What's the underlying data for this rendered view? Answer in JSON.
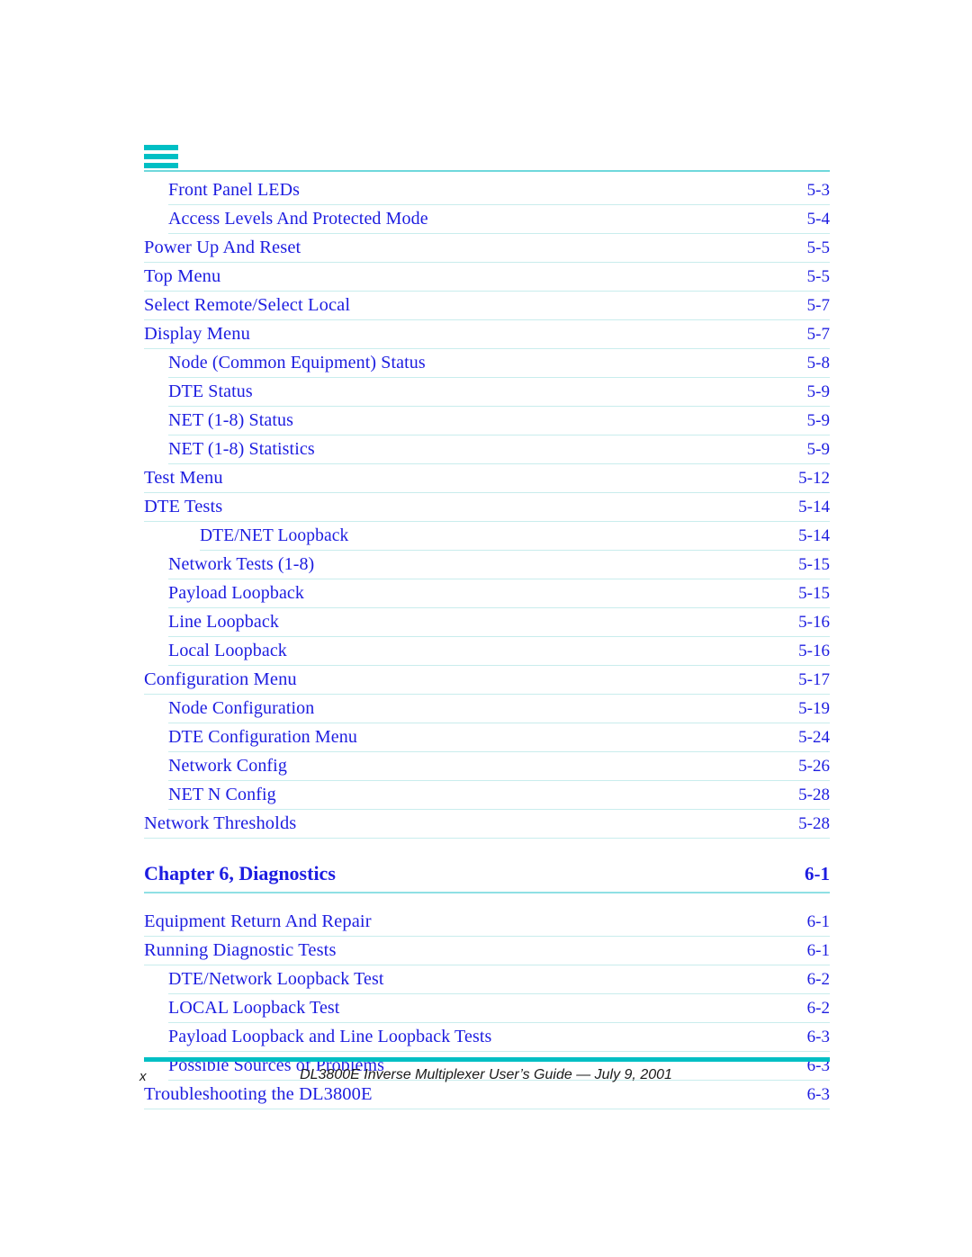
{
  "document": {
    "footer_text": "DL3800E Inverse Multiplexer User’s Guide — July 9, 2001",
    "folio": "x"
  },
  "header": {
    "mark_icon": "three-bar-mark-icon",
    "mark_color": "#00bfc4"
  },
  "colors": {
    "link_blue": "#1d1de0",
    "teal": "#00bfc4",
    "rule_teal": "#c9eded"
  },
  "toc": {
    "entries": [
      {
        "label": "Front Panel LEDs",
        "page": "5-3",
        "level": 2
      },
      {
        "label": "Access Levels And Protected Mode",
        "page": "5-4",
        "level": 2
      },
      {
        "label": "Power Up And Reset",
        "page": "5-5",
        "level": 1
      },
      {
        "label": "Top Menu",
        "page": "5-5",
        "level": 1
      },
      {
        "label": "Select Remote/Select Local",
        "page": "5-7",
        "level": 1
      },
      {
        "label": "Display Menu",
        "page": "5-7",
        "level": 1
      },
      {
        "label": "Node (Common Equipment) Status",
        "page": "5-8",
        "level": 2
      },
      {
        "label": "DTE Status",
        "page": "5-9",
        "level": 2
      },
      {
        "label": "NET (1-8) Status",
        "page": "5-9",
        "level": 2
      },
      {
        "label": "NET (1-8) Statistics",
        "page": "5-9",
        "level": 2
      },
      {
        "label": "Test Menu",
        "page": "5-12",
        "level": 1
      },
      {
        "label": "DTE Tests",
        "page": "5-14",
        "level": 1
      },
      {
        "label": "DTE/NET Loopback",
        "page": "5-14",
        "level": 3
      },
      {
        "label": "Network Tests (1-8)",
        "page": "5-15",
        "level": 2
      },
      {
        "label": "Payload Loopback",
        "page": "5-15",
        "level": 2
      },
      {
        "label": "Line Loopback",
        "page": "5-16",
        "level": 2
      },
      {
        "label": "Local Loopback",
        "page": "5-16",
        "level": 2
      },
      {
        "label": "Configuration Menu",
        "page": "5-17",
        "level": 1
      },
      {
        "label": "Node Configuration",
        "page": "5-19",
        "level": 2
      },
      {
        "label": "DTE Configuration Menu",
        "page": "5-24",
        "level": 2
      },
      {
        "label": "Network Config",
        "page": "5-26",
        "level": 2
      },
      {
        "label": "NET N Config",
        "page": "5-28",
        "level": 2
      },
      {
        "label": "Network Thresholds",
        "page": "5-28",
        "level": 1
      }
    ],
    "chapter": {
      "label": "Chapter 6, Diagnostics",
      "page": "6-1"
    },
    "entries_after_chapter": [
      {
        "label": "Equipment Return And Repair",
        "page": "6-1",
        "level": 1
      },
      {
        "label": "Running Diagnostic Tests",
        "page": "6-1",
        "level": 1
      },
      {
        "label": "DTE/Network Loopback Test",
        "page": "6-2",
        "level": 2
      },
      {
        "label": "LOCAL Loopback Test",
        "page": "6-2",
        "level": 2
      },
      {
        "label": "Payload Loopback and Line Loopback Tests",
        "page": "6-3",
        "level": 2
      },
      {
        "label": "Possible Sources of Problems",
        "page": "6-3",
        "level": 2
      },
      {
        "label": "Troubleshooting the DL3800E",
        "page": "6-3",
        "level": 1
      }
    ]
  }
}
